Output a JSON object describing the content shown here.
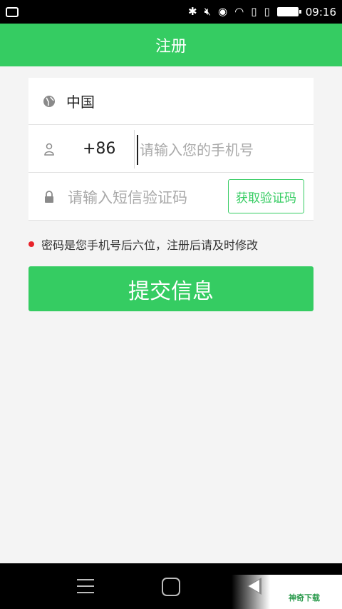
{
  "status_bar": {
    "time": "09:16",
    "icons": [
      "message-icon",
      "bluetooth-icon",
      "mute-icon",
      "eye-icon",
      "wifi-icon",
      "sim-icon",
      "sim-icon",
      "battery-icon"
    ]
  },
  "header": {
    "title": "注册"
  },
  "form": {
    "country": "中国",
    "dial_code": "+86",
    "phone_placeholder": "请输入您的手机号",
    "code_placeholder": "请输入短信验证码",
    "get_code_label": "获取验证码"
  },
  "notice": {
    "text": "密码是您手机号后六位，注册后请及时修改"
  },
  "submit": {
    "label": "提交信息"
  },
  "watermark": {
    "text": "神奇下载"
  },
  "colors": {
    "accent": "#35cc62",
    "dot": "#e8232a"
  }
}
